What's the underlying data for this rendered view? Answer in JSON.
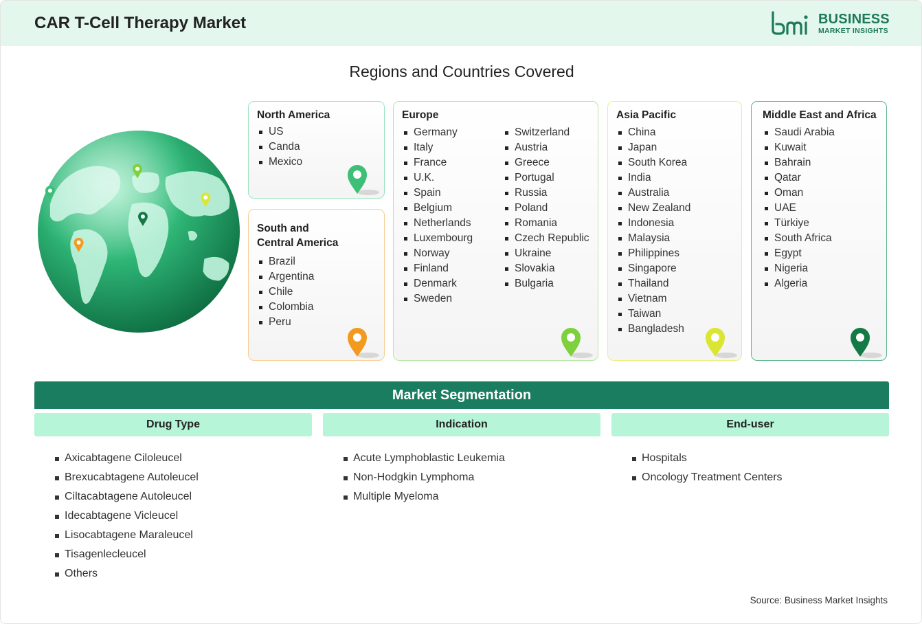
{
  "header": {
    "title": "CAR T-Cell Therapy Market"
  },
  "logo": {
    "line1": "BUSINESS",
    "line2": "MARKET INSIGHTS"
  },
  "regions_title": "Regions and Countries Covered",
  "regions": {
    "north_america": {
      "title": "North America",
      "items": [
        "US",
        "Canda",
        "Mexico"
      ],
      "pin_color": "#3dbf78",
      "border": "#9be3bd"
    },
    "south_america": {
      "title_line1": "South and",
      "title_line2": "Central America",
      "items": [
        "Brazil",
        "Argentina",
        "Chile",
        "Colombia",
        "Peru"
      ],
      "pin_color": "#f29a1f",
      "border": "#f7cd95"
    },
    "europe": {
      "title": "Europe",
      "col1": [
        "Germany",
        "Italy",
        "France",
        "U.K.",
        "Spain",
        "Belgium",
        "Netherlands",
        "Luxembourg",
        "Norway",
        "Finland",
        "Denmark",
        "Sweden"
      ],
      "col2": [
        "Switzerland",
        "Austria",
        "Greece",
        "Portugal",
        "Russia",
        "Poland",
        "Romania",
        "Czech Republic",
        "Ukraine",
        "Slovakia",
        "Bulgaria"
      ],
      "pin_color": "#7ed13c",
      "border": "#b6e6a2"
    },
    "asia_pacific": {
      "title": "Asia Pacific",
      "items": [
        "China",
        "Japan",
        "South Korea",
        "India",
        "Australia",
        "New Zealand",
        "Indonesia",
        "Malaysia",
        "Philippines",
        "Singapore",
        "Thailand",
        "Vietnam",
        "Taiwan",
        "Bangladesh"
      ],
      "pin_color": "#dbe634",
      "border": "#eaf07a"
    },
    "mea": {
      "title": "Middle East and Africa",
      "items": [
        "Saudi Arabia",
        "Kuwait",
        "Bahrain",
        "Qatar",
        "Oman",
        "UAE",
        "Türkiye",
        "South Africa",
        "Egypt",
        "Nigeria",
        "Algeria"
      ],
      "pin_color": "#147a45",
      "border": "#5cb48c"
    }
  },
  "segmentation": {
    "title": "Market Segmentation",
    "columns": [
      {
        "heading": "Drug Type",
        "items": [
          "Axicabtagene Ciloleucel",
          "Brexucabtagene Autoleucel",
          "Ciltacabtagene Autoleucel",
          "Idecabtagene Vicleucel",
          "Lisocabtagene Maraleucel",
          "Tisagenlecleucel",
          "Others"
        ]
      },
      {
        "heading": "Indication",
        "items": [
          "Acute Lymphoblastic Leukemia",
          "Non-Hodgkin Lymphoma",
          "Multiple Myeloma"
        ]
      },
      {
        "heading": "End-user",
        "items": [
          "Hospitals",
          "Oncology Treatment Centers"
        ]
      }
    ]
  },
  "source": "Source: Business Market Insights",
  "colors": {
    "brand": "#1b7d5f",
    "header_bg": "#e3f7ec",
    "sub_header_bg": "#b6f5d8"
  }
}
